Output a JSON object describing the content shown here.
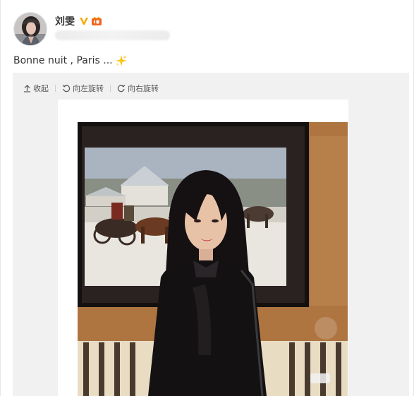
{
  "user": {
    "name": "刘雯",
    "verified_icon": "verified-v-icon",
    "member_icon": "vip-member-icon",
    "verified_color": "#f7a800",
    "member_color": "#f0651f"
  },
  "post": {
    "text": "Bonne nuit , Paris ...",
    "emoji": "sparkle-icon"
  },
  "toolbar": {
    "collapse_label": "收起",
    "rotate_left_label": "向左旋转",
    "rotate_right_label": "向右旋转"
  },
  "colors": {
    "link": "#555555",
    "card_bg": "#ffffff",
    "media_bg": "#f1f1f1"
  }
}
